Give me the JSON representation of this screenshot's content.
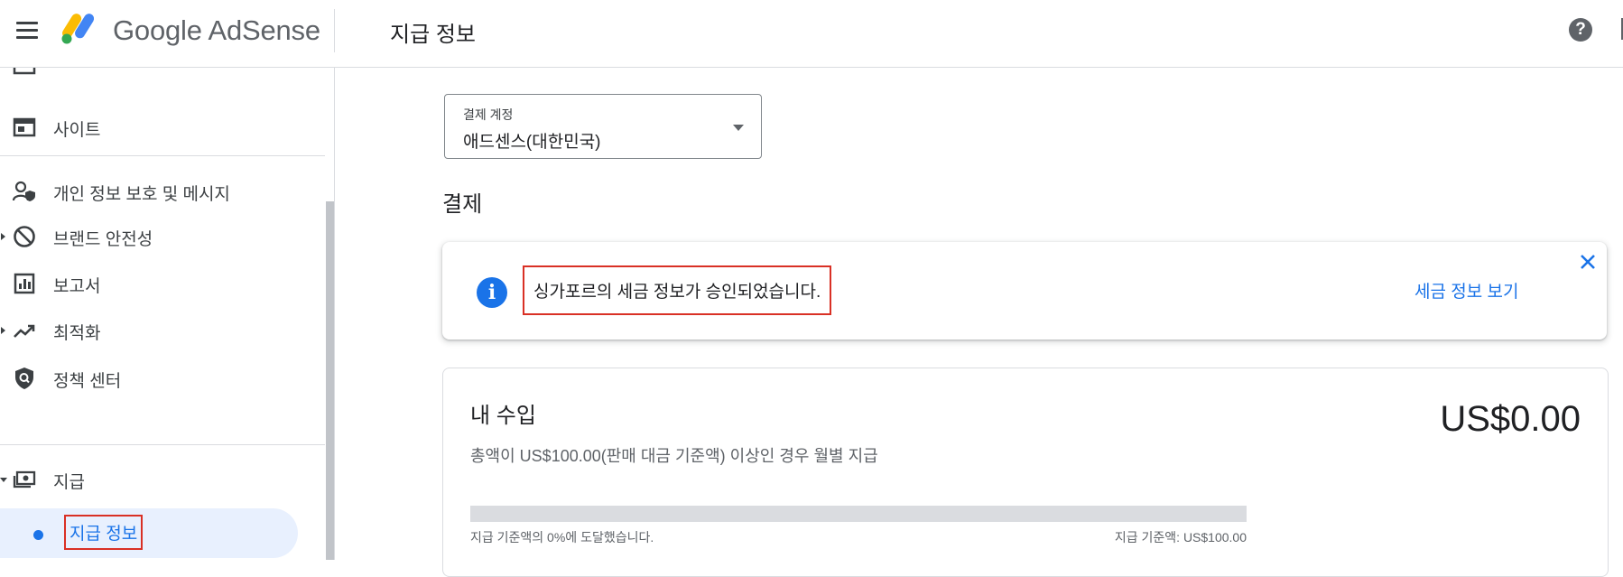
{
  "header": {
    "brand": "Google AdSense",
    "page_title": "지급 정보",
    "help_glyph": "?"
  },
  "sidebar": {
    "items": [
      {
        "label": "사이트",
        "icon": "web-layout-icon"
      },
      {
        "label": "개인 정보 보호 및 메시지",
        "icon": "person-shield-icon"
      },
      {
        "label": "브랜드 안전성",
        "icon": "block-icon"
      },
      {
        "label": "보고서",
        "icon": "bar-chart-icon"
      },
      {
        "label": "최적화",
        "icon": "trending-up-icon"
      },
      {
        "label": "정책 센터",
        "icon": "shield-search-icon"
      },
      {
        "label": "지급",
        "icon": "payments-icon"
      },
      {
        "label": "지급 정보",
        "icon": "dot-icon"
      }
    ]
  },
  "billing_account": {
    "label": "결제 계정",
    "value": "애드센스(대한민국)"
  },
  "payments": {
    "section_title": "결제"
  },
  "alert": {
    "message": "싱가포르의 세금 정보가 승인되었습니다.",
    "link": "세금 정보 보기",
    "info_glyph": "i"
  },
  "earnings": {
    "title": "내 수입",
    "amount": "US$0.00",
    "description": "총액이 US$100.00(판매 대금 기준액) 이상인 경우 월별 지급",
    "progress_percent": 0,
    "progress_left": "지급 기준액의 0%에 도달했습니다.",
    "progress_right": "지급 기준액: US$100.00"
  },
  "colors": {
    "accent": "#1a73e8",
    "highlight_border": "#d93025",
    "active_bg": "#e8f0fe"
  }
}
